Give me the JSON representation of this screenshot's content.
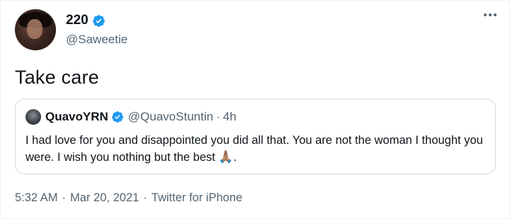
{
  "author": {
    "display_name": "220",
    "handle": "@Saweetie",
    "verified": true,
    "avatar_icon": "avatar-photo"
  },
  "tweet": {
    "text": "Take care"
  },
  "quoted_tweet": {
    "display_name": "QuavoYRN",
    "handle": "@QuavoStuntin",
    "separator": "·",
    "time": "4h",
    "verified": true,
    "text": "I had love for you and disappointed you did all that. You are not the woman I thought you were.  I wish you nothing but the best ",
    "emoji": "🙏🏽",
    "trailing": "."
  },
  "meta": {
    "time": "5:32 AM",
    "date": "Mar 20, 2021",
    "source": "Twitter for iPhone",
    "separator": "·"
  },
  "colors": {
    "accent": "#1d9bf0",
    "secondary_text": "#536471",
    "border": "#cfd9de"
  }
}
